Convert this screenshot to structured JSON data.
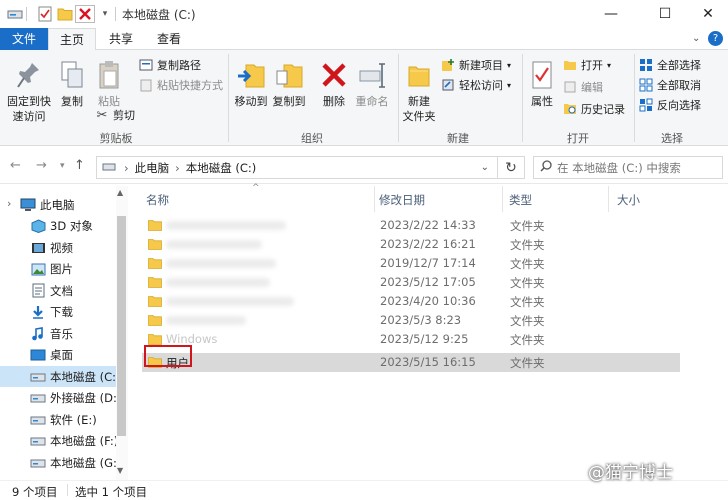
{
  "window": {
    "title": "本地磁盘 (C:)",
    "controls": {
      "minimize": "—",
      "maximize": "☐",
      "close": "✕"
    }
  },
  "tabs": [
    {
      "label": "文件"
    },
    {
      "label": "主页"
    },
    {
      "label": "共享"
    },
    {
      "label": "查看"
    }
  ],
  "ribbon": {
    "pin_label_1": "固定到快",
    "pin_label_2": "速访问",
    "copy": "复制",
    "paste": "粘贴",
    "copy_path": "复制路径",
    "paste_shortcut": "粘贴快捷方式",
    "cut": "剪切",
    "group_clipboard": "剪贴板",
    "move_to": "移动到",
    "copy_to": "复制到",
    "delete": "删除",
    "rename": "重命名",
    "group_organize": "组织",
    "new_folder_1": "新建",
    "new_folder_2": "文件夹",
    "new_item": "新建项目",
    "easy_access": "轻松访问",
    "group_new": "新建",
    "properties": "属性",
    "open": "打开",
    "edit": "编辑",
    "history": "历史记录",
    "group_open": "打开",
    "select_all": "全部选择",
    "select_none": "全部取消",
    "invert": "反向选择",
    "group_select": "选择"
  },
  "address": {
    "segments": [
      "此电脑",
      "本地磁盘 (C:)"
    ],
    "separator": "›",
    "search_placeholder": "在 本地磁盘 (C:) 中搜索"
  },
  "nav": [
    {
      "label": "此电脑",
      "icon": "pc-icon"
    },
    {
      "label": "3D 对象",
      "icon": "cube-icon"
    },
    {
      "label": "视频",
      "icon": "video-icon"
    },
    {
      "label": "图片",
      "icon": "picture-icon"
    },
    {
      "label": "文档",
      "icon": "document-icon"
    },
    {
      "label": "下载",
      "icon": "download-icon"
    },
    {
      "label": "音乐",
      "icon": "music-icon"
    },
    {
      "label": "桌面",
      "icon": "desktop-icon"
    },
    {
      "label": "本地磁盘 (C:)",
      "icon": "drive-icon"
    },
    {
      "label": "外接磁盘 (D:)",
      "icon": "drive-icon"
    },
    {
      "label": "软件 (E:)",
      "icon": "drive-icon"
    },
    {
      "label": "本地磁盘 (F:)",
      "icon": "drive-icon"
    },
    {
      "label": "本地磁盘 (G:)",
      "icon": "drive-icon"
    }
  ],
  "columns": {
    "name": "名称",
    "date": "修改日期",
    "type": "类型",
    "size": "大小"
  },
  "files": [
    {
      "name": "",
      "date": "2023/2/22 14:33",
      "type": "文件夹"
    },
    {
      "name": "",
      "date": "2023/2/22 16:21",
      "type": "文件夹"
    },
    {
      "name": "",
      "date": "2019/12/7 17:14",
      "type": "文件夹"
    },
    {
      "name": "",
      "date": "2023/5/12 17:05",
      "type": "文件夹"
    },
    {
      "name": "",
      "date": "2023/4/20 10:36",
      "type": "文件夹"
    },
    {
      "name": "",
      "date": "2023/5/3 8:23",
      "type": "文件夹"
    },
    {
      "name": "Windows",
      "date": "2023/5/12 9:25",
      "type": "文件夹"
    },
    {
      "name": "用户",
      "date": "2023/5/15 16:15",
      "type": "文件夹"
    }
  ],
  "status": {
    "count": "9 个项目",
    "selected": "选中 1 个项目"
  },
  "watermark": "@猫宁博士",
  "colors": {
    "accent": "#1a6ec8",
    "folder": "#f6c94a",
    "highlight_box": "#d0161c",
    "selected_row": "#d9d9d9"
  }
}
